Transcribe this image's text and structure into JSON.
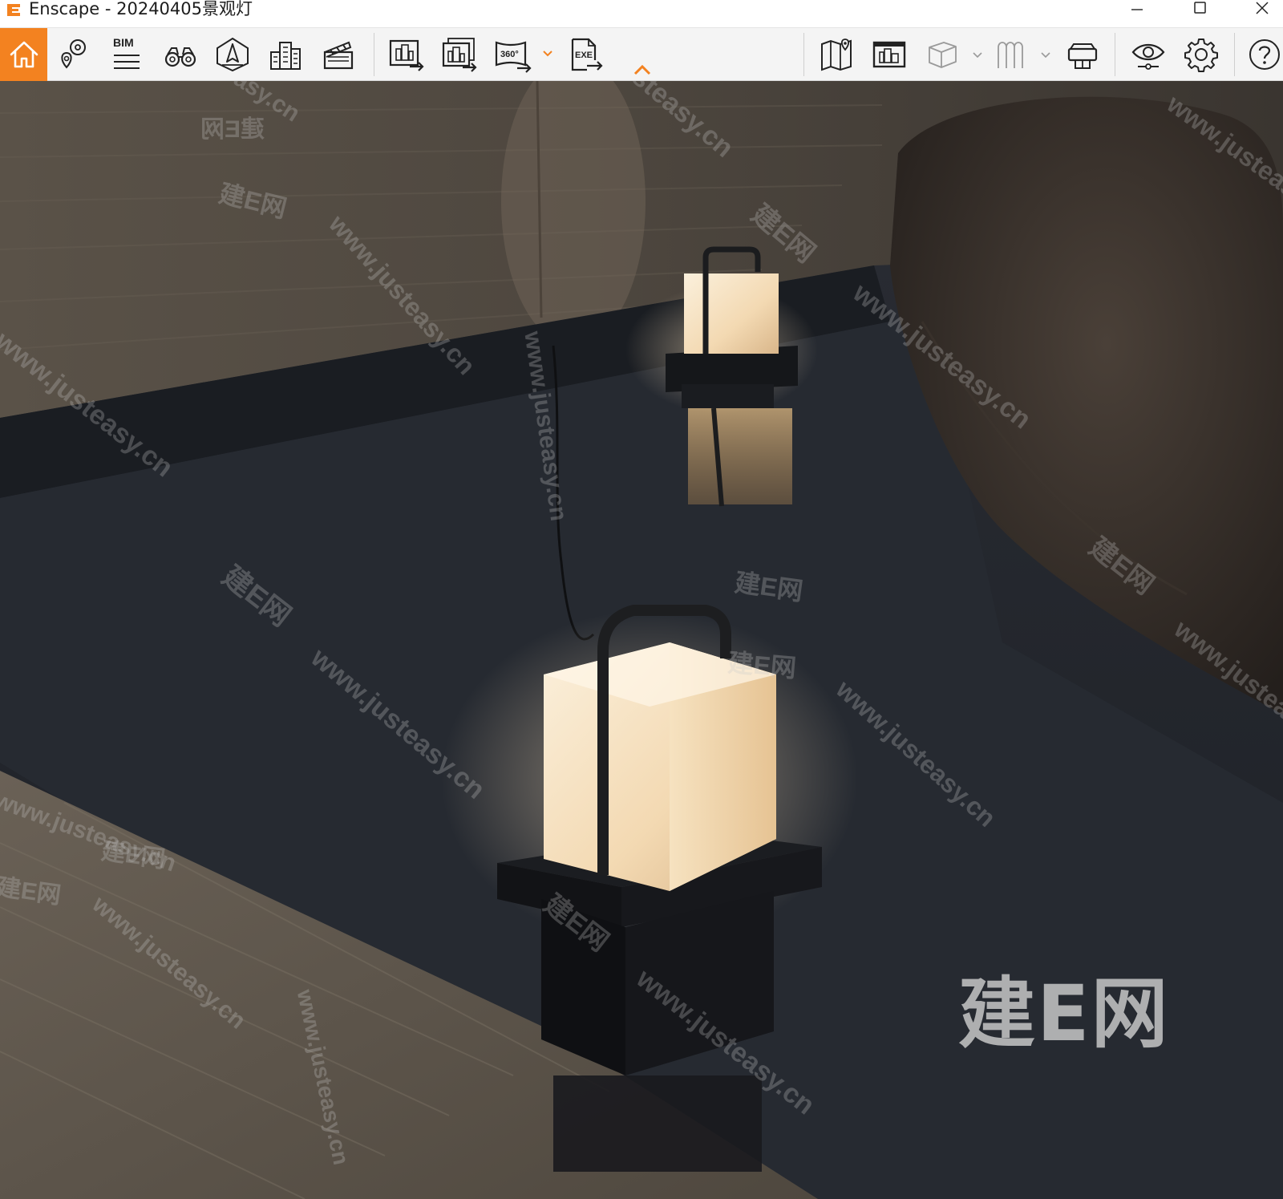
{
  "window": {
    "title": "Enscape - 20240405景观灯",
    "logo_icon": "enscape-logo-icon",
    "accent_color": "#f38220"
  },
  "toolbar": {
    "bim_label": "BIM",
    "view_360_label": "360°",
    "exe_label": "EXE",
    "buttons": [
      "home-icon",
      "location-pin-icon",
      "bim-icon",
      "binoculars-icon",
      "compass-icon",
      "buildings-icon",
      "clapperboard-icon",
      "render-export-icon",
      "batch-render-icon",
      "panorama-360-icon",
      "exe-export-icon",
      "collapse-caret-icon",
      "map-icon",
      "asset-library-icon",
      "cube-icon",
      "people-icon",
      "vr-headset-icon",
      "eye-icon",
      "settings-gear-icon",
      "help-icon"
    ]
  },
  "viewport": {
    "watermarks": [
      "www.justeasy.cn",
      "建E网"
    ],
    "brand_watermark": "建E网"
  }
}
